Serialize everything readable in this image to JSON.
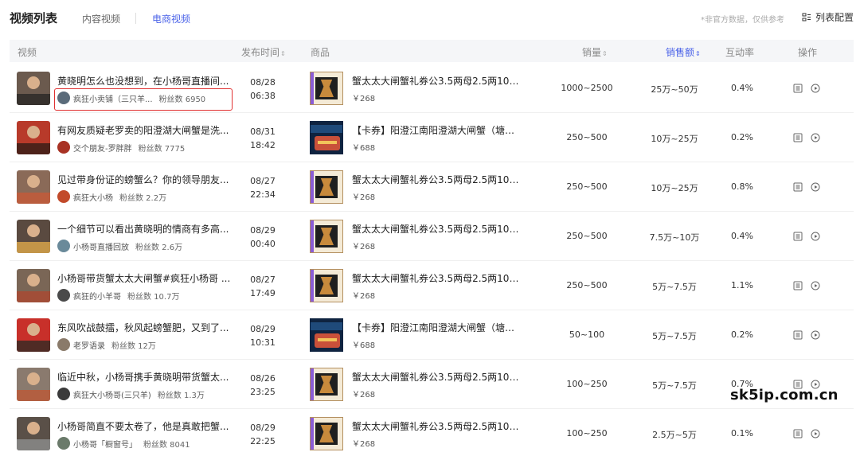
{
  "page": {
    "title": "视频列表",
    "tabs": [
      {
        "label": "内容视频",
        "active": false
      },
      {
        "label": "电商视频",
        "active": true
      }
    ],
    "note": "*非官方数据，仅供参考",
    "config_label": "列表配置"
  },
  "columns": {
    "video": "视频",
    "time": "发布时间",
    "product": "商品",
    "volume": "销量",
    "amount": "销售额",
    "rate": "互动率",
    "action": "操作"
  },
  "sort_icon": "⇕",
  "colors": {
    "accent": "#4a62e8",
    "highlight_border": "#e03131"
  },
  "rows": [
    {
      "title": "黄晓明怎么也没想到，在小杨哥直播间...",
      "author": "疯狂小卖铺（三只羊...",
      "fans": "粉丝数 6950",
      "date": "08/28",
      "clock": "06:38",
      "product": "蟹太太大闸蟹礼券公3.5两母2.5两10只...",
      "price": "￥268",
      "volume": "1000~2500",
      "amount": "25万~50万",
      "rate": "0.4%",
      "highlighted": true,
      "thumb_colors": [
        "#6b5a4e",
        "#2d2a28"
      ],
      "avatar_color": "#5a6b7a",
      "product_style": "style1"
    },
    {
      "title": "有网友质疑老罗卖的阳澄湖大闸蟹是洗...",
      "author": "交个朋友-罗胖胖",
      "fans": "粉丝数 7775",
      "date": "08/31",
      "clock": "18:42",
      "product": "【卡券】阳澄江南阳澄湖大闸蟹（塘养...",
      "price": "￥688",
      "volume": "250~500",
      "amount": "10万~25万",
      "rate": "0.2%",
      "highlighted": false,
      "thumb_colors": [
        "#b83a2a",
        "#3a1f18"
      ],
      "avatar_color": "#a83224",
      "product_style": "style2"
    },
    {
      "title": "见过带身份证的螃蟹么？你的领导朋友...",
      "author": "疯狂大小杨",
      "fans": "粉丝数 2.2万",
      "date": "08/27",
      "clock": "22:34",
      "product": "蟹太太大闸蟹礼券公3.5两母2.5两10只...",
      "price": "￥268",
      "volume": "250~500",
      "amount": "10万~25万",
      "rate": "0.8%",
      "highlighted": false,
      "thumb_colors": [
        "#8a6a58",
        "#c25a3a"
      ],
      "avatar_color": "#c24a2a",
      "product_style": "style1"
    },
    {
      "title": "一个细节可以看出黄晓明的情商有多高...",
      "author": "小杨哥直播回放",
      "fans": "粉丝数 2.6万",
      "date": "08/29",
      "clock": "00:40",
      "product": "蟹太太大闸蟹礼券公3.5两母2.5两10只...",
      "price": "￥268",
      "volume": "250~500",
      "amount": "7.5万~10万",
      "rate": "0.4%",
      "highlighted": false,
      "thumb_colors": [
        "#5a4a40",
        "#d6a24a"
      ],
      "avatar_color": "#6a8a9a",
      "product_style": "style1"
    },
    {
      "title": "小杨哥带货蟹太太大闸蟹#疯狂小杨哥 ...",
      "author": "疯狂的小羊哥",
      "fans": "粉丝数 10.7万",
      "date": "08/27",
      "clock": "17:49",
      "product": "蟹太太大闸蟹礼券公3.5两母2.5两10只...",
      "price": "￥268",
      "volume": "250~500",
      "amount": "5万~7.5万",
      "rate": "1.1%",
      "highlighted": false,
      "thumb_colors": [
        "#7a6656",
        "#a84a32"
      ],
      "avatar_color": "#4a4a4a",
      "product_style": "style1"
    },
    {
      "title": "东风吹战鼓擂，秋风起螃蟹肥，又到了...",
      "author": "老罗语录",
      "fans": "粉丝数 12万",
      "date": "08/29",
      "clock": "10:31",
      "product": "【卡券】阳澄江南阳澄湖大闸蟹（塘养...",
      "price": "￥688",
      "volume": "50~100",
      "amount": "5万~7.5万",
      "rate": "0.2%",
      "highlighted": false,
      "thumb_colors": [
        "#c8302a",
        "#3a2a24"
      ],
      "avatar_color": "#8a7a6a",
      "product_style": "style2"
    },
    {
      "title": "临近中秋，小杨哥携手黄晓明带货蟹太...",
      "author": "疯狂大小杨哥(三只羊)",
      "fans": "粉丝数 1.3万",
      "date": "08/26",
      "clock": "23:25",
      "product": "蟹太太大闸蟹礼券公3.5两母2.5两10只...",
      "price": "￥268",
      "volume": "100~250",
      "amount": "5万~7.5万",
      "rate": "0.7%",
      "highlighted": false,
      "thumb_colors": [
        "#8a7a6e",
        "#b85a3a"
      ],
      "avatar_color": "#3a3a3a",
      "product_style": "style1"
    },
    {
      "title": "小杨哥简直不要太卷了，他是真敢把蟹...",
      "author": "小杨哥「橱窗号」",
      "fans": "粉丝数 8041",
      "date": "08/29",
      "clock": "22:25",
      "product": "蟹太太大闸蟹礼券公3.5两母2.5两10只...",
      "price": "￥268",
      "volume": "100~250",
      "amount": "2.5万~5万",
      "rate": "0.1%",
      "highlighted": false,
      "thumb_colors": [
        "#5a5048",
        "#8a8a8a"
      ],
      "avatar_color": "#6a7a6a",
      "product_style": "style1"
    }
  ],
  "watermark": "sk5ip.com.cn"
}
